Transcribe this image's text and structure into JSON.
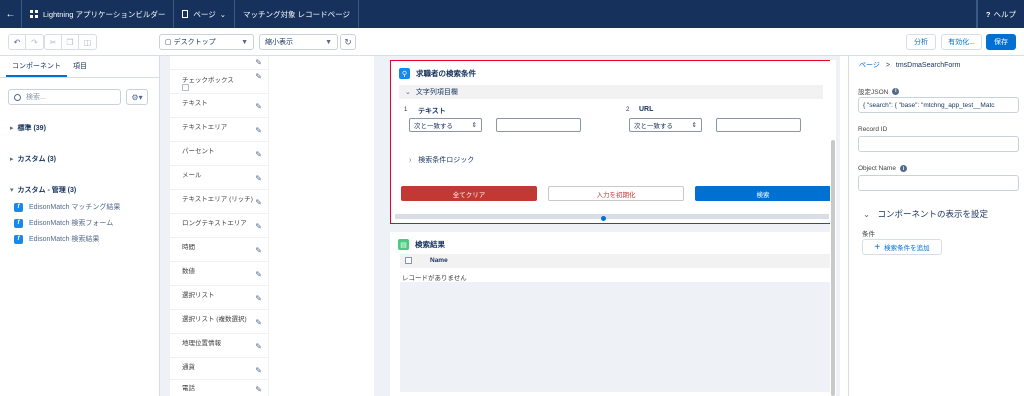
{
  "topbar": {
    "back_icon": "back-arrow-icon",
    "app_title": "Lightning アプリケーションビルダー",
    "page_menu": "ページ",
    "page_title": "マッチング対象 レコードページ",
    "help": "ヘルプ"
  },
  "toolbar": {
    "device_select": "デスクトップ",
    "view_select": "縮小表示",
    "analyze": "分析",
    "activate": "有効化...",
    "save": "保存"
  },
  "left_panel": {
    "tabs": [
      "コンポーネント",
      "項目"
    ],
    "search_placeholder": "検索...",
    "sections": [
      {
        "label": "標準 (39)"
      },
      {
        "label": "カスタム (3)"
      },
      {
        "label": "カスタム - 管理 (3)"
      }
    ],
    "managed_components": [
      "EdisonMatch マッチング結果",
      "EdisonMatch 検索フォーム",
      "EdisonMatch 検索結果"
    ]
  },
  "field_list": [
    "チェックボックス",
    "テキスト",
    "テキストエリア",
    "パーセント",
    "メール",
    "テキストエリア (リッチ)",
    "ロングテキストエリア",
    "時間",
    "数値",
    "選択リスト",
    "選択リスト (複数選択)",
    "地理位置情報",
    "通貨",
    "電話"
  ],
  "search_card": {
    "title": "求職者の検索条件",
    "accordion": "文字列項目欄",
    "field1": {
      "num": "1",
      "label": "テキスト",
      "operator": "次と一致する"
    },
    "field2": {
      "num": "2",
      "label": "URL",
      "operator": "次と一致する"
    },
    "logic": "検索条件ロジック",
    "clear_all": "全てクリア",
    "reset": "入力を初期化",
    "search": "検索",
    "colors": {
      "clear": "#c23934",
      "search": "#0070d2",
      "selected_border": "#e4002b"
    }
  },
  "results_card": {
    "title": "検索結果",
    "column_name": "Name",
    "empty_text": "レコードがありません"
  },
  "right_panel": {
    "breadcrumb_link": "ページ",
    "breadcrumb_sep": ">",
    "breadcrumb_current": "tmsDmaSearchForm",
    "settings_json_label": "設定JSON",
    "settings_json_value": "{ \"search\": {     \"base\": \"mtchng_app_test__Matc",
    "record_id_label": "Record ID",
    "object_name_label": "Object Name",
    "visibility_title": "コンポーネントの表示を設定",
    "condition_label": "条件",
    "add_condition": "検索条件を追加"
  }
}
